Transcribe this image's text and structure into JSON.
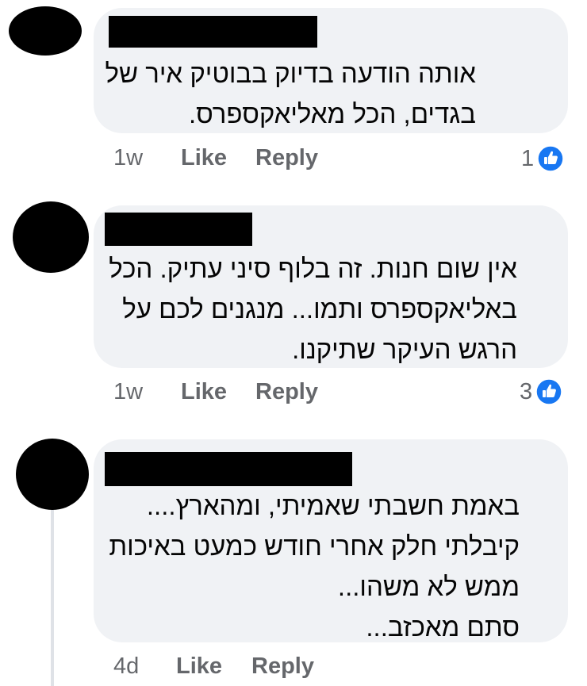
{
  "comments": [
    {
      "text": "אותה הודעה בדיוק בבוטיק איר של\nבגדים, הכל מאליאקספרס.",
      "time": "1w",
      "like_label": "Like",
      "reply_label": "Reply",
      "reaction_count": "1"
    },
    {
      "text": "אין שום חנות. זה בלוף סיני עתיק. הכל\nבאליאקספרס ותמו...  מנגנים לכם על\nהרגש העיקר שתיקנו.",
      "time": "1w",
      "like_label": "Like",
      "reply_label": "Reply",
      "reaction_count": "3"
    },
    {
      "text": "באמת חשבתי שאמיתי, ומהארץ....\nקיבלתי חלק אחרי חודש כמעט באיכות\nממש לא משהו...\nסתם מאכזב...",
      "time": "4d",
      "like_label": "Like",
      "reply_label": "Reply"
    }
  ],
  "colors": {
    "bubble": "#f0f2f5",
    "action_text": "#65676b",
    "like_blue": "#1877f2"
  },
  "icons": {
    "reaction": "like-thumbs-up-icon"
  }
}
